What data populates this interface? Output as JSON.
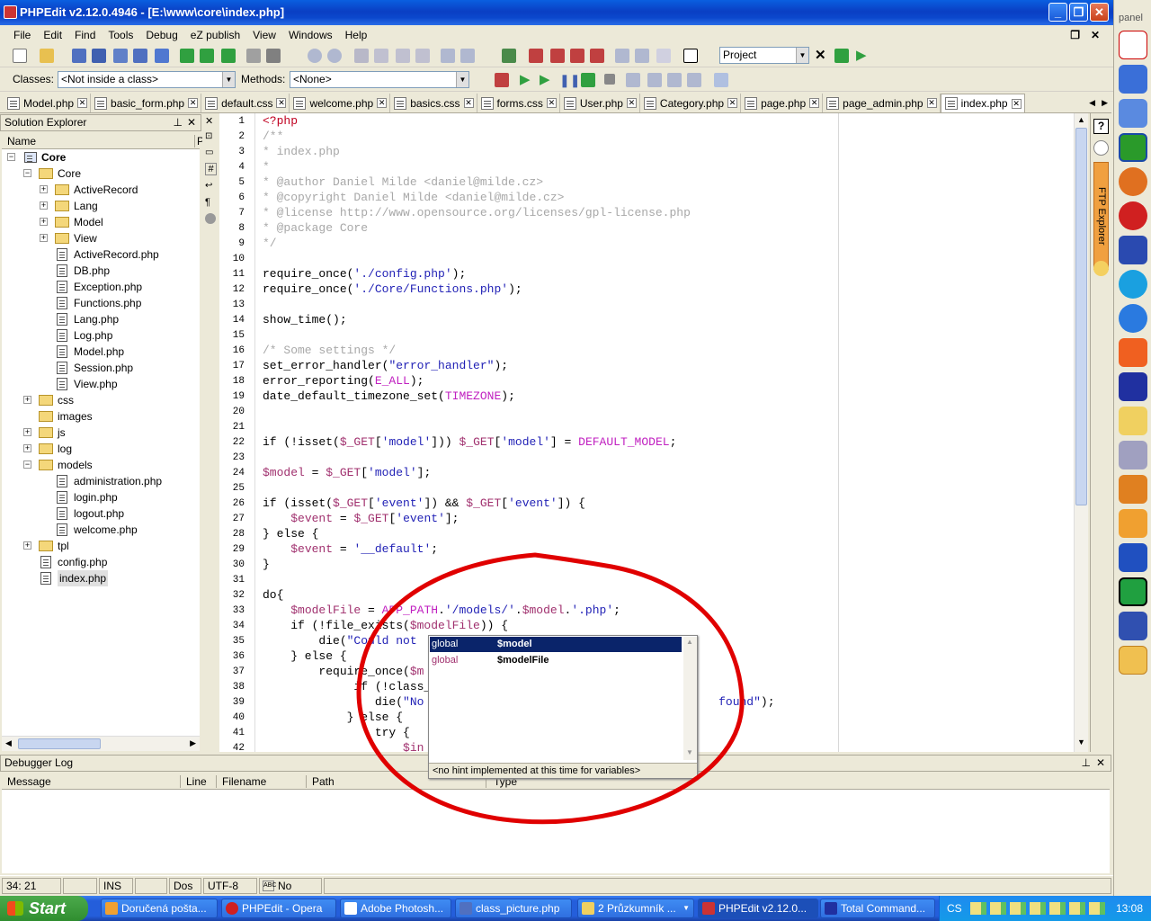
{
  "window": {
    "title": "PHPEdit v2.12.0.4946 - [E:\\www\\core\\index.php]"
  },
  "menu": [
    "File",
    "Edit",
    "Find",
    "Tools",
    "Debug",
    "eZ publish",
    "View",
    "Windows",
    "Help"
  ],
  "toolbar": {
    "project_combo": "Project",
    "classes_label": "Classes:",
    "classes_value": "<Not inside a class>",
    "methods_label": "Methods:",
    "methods_value": "<None>"
  },
  "tabs": [
    "Model.php",
    "basic_form.php",
    "default.css",
    "welcome.php",
    "basics.css",
    "forms.css",
    "User.php",
    "Category.php",
    "page.php",
    "page_admin.php",
    "index.php"
  ],
  "solution_explorer": {
    "title": "Solution Explorer",
    "col_name": "Name",
    "col_p": "P",
    "items": [
      {
        "label": "Core",
        "type": "project",
        "level": 0,
        "expander": "−"
      },
      {
        "label": "Core",
        "type": "folder-open",
        "level": 1,
        "expander": "−"
      },
      {
        "label": "ActiveRecord",
        "type": "folder",
        "level": 2,
        "expander": "+"
      },
      {
        "label": "Lang",
        "type": "folder",
        "level": 2,
        "expander": "+"
      },
      {
        "label": "Model",
        "type": "folder",
        "level": 2,
        "expander": "+"
      },
      {
        "label": "View",
        "type": "folder",
        "level": 2,
        "expander": "+"
      },
      {
        "label": "ActiveRecord.php",
        "type": "file",
        "level": 2,
        "expander": ""
      },
      {
        "label": "DB.php",
        "type": "file",
        "level": 2,
        "expander": ""
      },
      {
        "label": "Exception.php",
        "type": "file",
        "level": 2,
        "expander": ""
      },
      {
        "label": "Functions.php",
        "type": "file",
        "level": 2,
        "expander": ""
      },
      {
        "label": "Lang.php",
        "type": "file",
        "level": 2,
        "expander": ""
      },
      {
        "label": "Log.php",
        "type": "file",
        "level": 2,
        "expander": ""
      },
      {
        "label": "Model.php",
        "type": "file",
        "level": 2,
        "expander": ""
      },
      {
        "label": "Session.php",
        "type": "file",
        "level": 2,
        "expander": ""
      },
      {
        "label": "View.php",
        "type": "file",
        "level": 2,
        "expander": ""
      },
      {
        "label": "css",
        "type": "folder",
        "level": 1,
        "expander": "+"
      },
      {
        "label": "images",
        "type": "folder",
        "level": 1,
        "expander": ""
      },
      {
        "label": "js",
        "type": "folder",
        "level": 1,
        "expander": "+"
      },
      {
        "label": "log",
        "type": "folder",
        "level": 1,
        "expander": "+"
      },
      {
        "label": "models",
        "type": "folder-open",
        "level": 1,
        "expander": "−"
      },
      {
        "label": "administration.php",
        "type": "file",
        "level": 2,
        "expander": ""
      },
      {
        "label": "login.php",
        "type": "file",
        "level": 2,
        "expander": ""
      },
      {
        "label": "logout.php",
        "type": "file",
        "level": 2,
        "expander": ""
      },
      {
        "label": "welcome.php",
        "type": "file",
        "level": 2,
        "expander": ""
      },
      {
        "label": "tpl",
        "type": "folder",
        "level": 1,
        "expander": "+"
      },
      {
        "label": "config.php",
        "type": "file",
        "level": 1,
        "expander": ""
      },
      {
        "label": "index.php",
        "type": "file",
        "level": 1,
        "expander": "",
        "selected": true
      }
    ]
  },
  "code_lines": [
    [
      [
        "op",
        "<?php"
      ]
    ],
    [
      [
        "cm",
        "/**"
      ]
    ],
    [
      [
        "cm",
        "* index.php"
      ]
    ],
    [
      [
        "cm",
        "*"
      ]
    ],
    [
      [
        "cm",
        "* @author Daniel Milde <daniel@milde.cz>"
      ]
    ],
    [
      [
        "cm",
        "* @copyright Daniel Milde <daniel@milde.cz>"
      ]
    ],
    [
      [
        "cm",
        "* @license http://www.opensource.org/licenses/gpl-license.php"
      ]
    ],
    [
      [
        "cm",
        "* @package Core"
      ]
    ],
    [
      [
        "cm",
        "*/"
      ]
    ],
    [],
    [
      [
        "kw",
        "require_once("
      ],
      [
        "str",
        "'./config.php'"
      ],
      [
        "kw",
        ");"
      ]
    ],
    [
      [
        "kw",
        "require_once("
      ],
      [
        "str",
        "'./Core/Functions.php'"
      ],
      [
        "kw",
        ");"
      ]
    ],
    [],
    [
      [
        "kw",
        "show_time();"
      ]
    ],
    [],
    [
      [
        "cm",
        "/* Some settings */"
      ]
    ],
    [
      [
        "kw",
        "set_error_handler("
      ],
      [
        "str",
        "\"error_handler\""
      ],
      [
        "kw",
        ");"
      ]
    ],
    [
      [
        "kw",
        "error_reporting("
      ],
      [
        "const",
        "E_ALL"
      ],
      [
        "kw",
        ");"
      ]
    ],
    [
      [
        "kw",
        "date_default_timezone_set("
      ],
      [
        "const",
        "TIMEZONE"
      ],
      [
        "kw",
        ");"
      ]
    ],
    [],
    [],
    [
      [
        "kw",
        "if (!isset("
      ],
      [
        "var",
        "$_GET"
      ],
      [
        "kw",
        "["
      ],
      [
        "str",
        "'model'"
      ],
      [
        "kw",
        "])) "
      ],
      [
        "var",
        "$_GET"
      ],
      [
        "kw",
        "["
      ],
      [
        "str",
        "'model'"
      ],
      [
        "kw",
        "] = "
      ],
      [
        "const",
        "DEFAULT_MODEL"
      ],
      [
        "kw",
        ";"
      ]
    ],
    [],
    [
      [
        "var",
        "$model"
      ],
      [
        "kw",
        " = "
      ],
      [
        "var",
        "$_GET"
      ],
      [
        "kw",
        "["
      ],
      [
        "str",
        "'model'"
      ],
      [
        "kw",
        "];"
      ]
    ],
    [],
    [
      [
        "kw",
        "if (isset("
      ],
      [
        "var",
        "$_GET"
      ],
      [
        "kw",
        "["
      ],
      [
        "str",
        "'event'"
      ],
      [
        "kw",
        "]) && "
      ],
      [
        "var",
        "$_GET"
      ],
      [
        "kw",
        "["
      ],
      [
        "str",
        "'event'"
      ],
      [
        "kw",
        "]) {"
      ]
    ],
    [
      [
        "kw",
        "    "
      ],
      [
        "var",
        "$event"
      ],
      [
        "kw",
        " = "
      ],
      [
        "var",
        "$_GET"
      ],
      [
        "kw",
        "["
      ],
      [
        "str",
        "'event'"
      ],
      [
        "kw",
        "];"
      ]
    ],
    [
      [
        "kw",
        "} else {"
      ]
    ],
    [
      [
        "kw",
        "    "
      ],
      [
        "var",
        "$event"
      ],
      [
        "kw",
        " = "
      ],
      [
        "str",
        "'__default'"
      ],
      [
        "kw",
        ";"
      ]
    ],
    [
      [
        "kw",
        "}"
      ]
    ],
    [],
    [
      [
        "kw",
        "do{"
      ]
    ],
    [
      [
        "kw",
        "    "
      ],
      [
        "var",
        "$modelFile"
      ],
      [
        "kw",
        " = "
      ],
      [
        "const",
        "APP_PATH"
      ],
      [
        "kw",
        "."
      ],
      [
        "str",
        "'/models/'"
      ],
      [
        "kw",
        "."
      ],
      [
        "var",
        "$model"
      ],
      [
        "kw",
        "."
      ],
      [
        "str",
        "'.php'"
      ],
      [
        "kw",
        ";"
      ]
    ],
    [
      [
        "kw",
        "    if (!file_exists("
      ],
      [
        "var",
        "$modelFile"
      ],
      [
        "kw",
        ")) {"
      ]
    ],
    [
      [
        "kw",
        "        die("
      ],
      [
        "str",
        "\"Could not"
      ]
    ],
    [
      [
        "kw",
        "    } else {"
      ]
    ],
    [
      [
        "kw",
        "        require_once("
      ],
      [
        "var",
        "$m"
      ]
    ],
    [
      [
        "kw",
        "             if (!class_"
      ]
    ],
    [
      [
        "kw",
        "                die("
      ],
      [
        "str",
        "\"No"
      ],
      [
        "kw",
        "                                          "
      ],
      [
        "str",
        "found\""
      ],
      [
        "kw",
        ");"
      ]
    ],
    [
      [
        "kw",
        "            } else {"
      ]
    ],
    [
      [
        "kw",
        "                try {"
      ]
    ],
    [
      [
        "kw",
        "                    "
      ],
      [
        "var",
        "$in"
      ]
    ]
  ],
  "autocomplete": {
    "items": [
      {
        "scope": "global",
        "name": "$model",
        "selected": true
      },
      {
        "scope": "global",
        "name": "$modelFile",
        "selected": false
      }
    ],
    "hint": "<no hint implemented at this time for variables>"
  },
  "debugger": {
    "title": "Debugger Log",
    "columns": [
      "Message",
      "Line",
      "Filename",
      "Path",
      "Type"
    ]
  },
  "statusbar": {
    "position": "34: 21",
    "mode": "INS",
    "eol": "Dos",
    "encoding": "UTF-8",
    "errors": "No errors"
  },
  "side_tab_label": "FTP Explorer",
  "side_panel_label": "panel",
  "taskbar": {
    "start": "Start",
    "tasks": [
      "Doručená pošta...",
      "PHPEdit - Opera",
      "Adobe Photosh...",
      "class_picture.php",
      "2 Průzkumník ...",
      "PHPEdit v2.12.0...",
      "Total Command..."
    ],
    "tray_lang": "CS",
    "clock": "13:08"
  }
}
